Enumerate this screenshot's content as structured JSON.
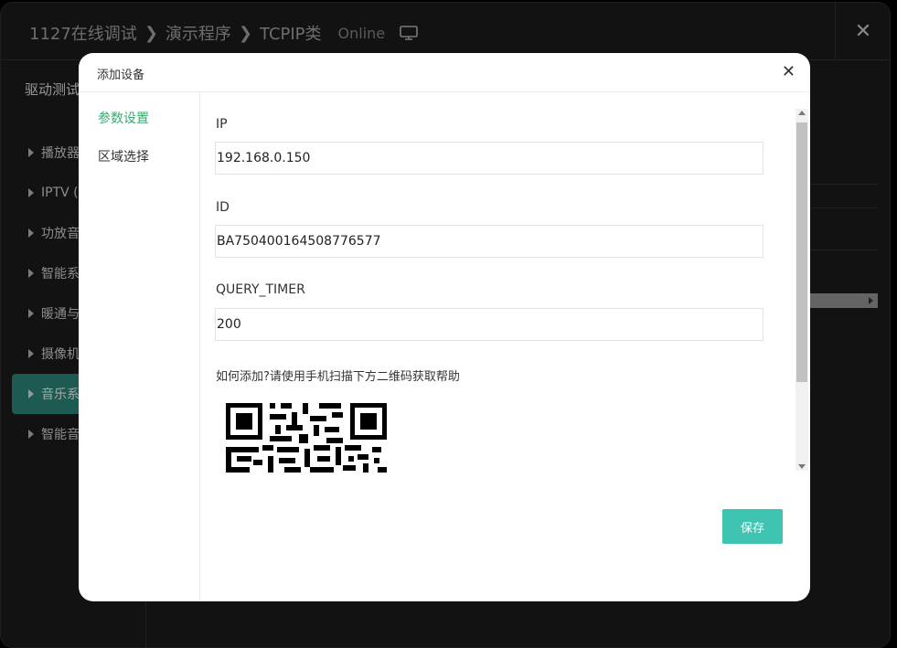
{
  "background": {
    "breadcrumb": [
      "1127在线调试",
      "演示程序",
      "TCPIP类"
    ],
    "status": "Online",
    "sidebar_title": "驱动测试",
    "list_items": [
      "播放器",
      "IPTV (I",
      "功放音",
      "智能系",
      "暖通与",
      "摄像机",
      "音乐系",
      "智能音"
    ],
    "active_index": 6
  },
  "modal": {
    "title": "添加设备",
    "nav": [
      "参数设置",
      "区域选择"
    ],
    "fields": [
      {
        "label": "IP",
        "value": "192.168.0.150"
      },
      {
        "label": "ID",
        "value": "BA750400164508776577"
      },
      {
        "label": "QUERY_TIMER",
        "value": "200"
      }
    ],
    "help_text": "如何添加?请使用手机扫描下方二维码获取帮助",
    "save_label": "保存"
  },
  "colors": {
    "accent": "#3fc4b2",
    "nav_active": "#3aa86f",
    "sidebar_active": "#2d8a7d"
  }
}
